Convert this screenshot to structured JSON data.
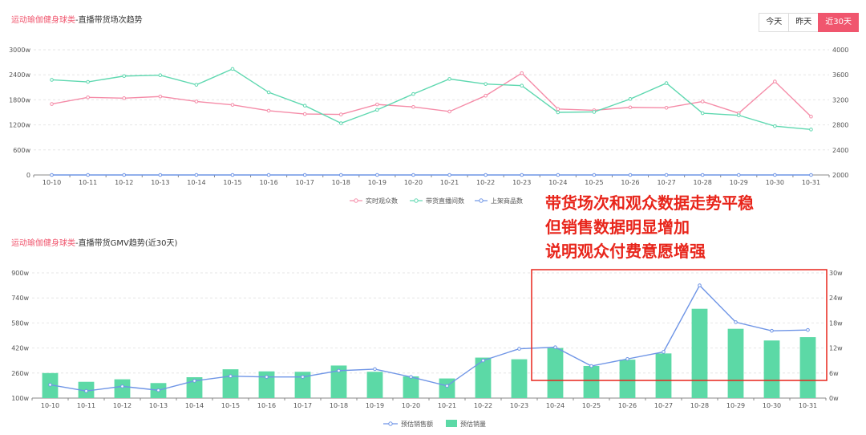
{
  "header": {
    "chart1_title_accent": "运动瑜伽健身球类",
    "chart1_title_rest": "-直播带货场次趋势",
    "chart2_title_accent": "运动瑜伽健身球类",
    "chart2_title_rest": "-直播带货GMV趋势(近30天)"
  },
  "range_buttons": [
    {
      "label": "今天",
      "active": false
    },
    {
      "label": "昨天",
      "active": false
    },
    {
      "label": "近30天",
      "active": true
    }
  ],
  "annotation": {
    "lines": [
      "带货场次和观众数据走势平稳",
      "但销售数据明显增加",
      "说明观众付费意愿增强"
    ],
    "color": "#e8251b"
  },
  "colors": {
    "pink": "#f58ca8",
    "teal": "#5fd8b0",
    "blue": "#6f95e6",
    "bar": "#5cd9a6"
  },
  "chart_data": [
    {
      "type": "line",
      "categories": [
        "10-10",
        "10-11",
        "10-12",
        "10-13",
        "10-14",
        "10-15",
        "10-16",
        "10-17",
        "10-18",
        "10-19",
        "10-20",
        "10-21",
        "10-22",
        "10-23",
        "10-24",
        "10-25",
        "10-26",
        "10-27",
        "10-28",
        "10-29",
        "10-30",
        "10-31"
      ],
      "y_left": {
        "min": 0,
        "max": 3000,
        "ticks": [
          "0",
          "600w",
          "1200w",
          "1800w",
          "2400w",
          "3000w"
        ]
      },
      "y_right": {
        "min": 2000,
        "max": 4000,
        "ticks": [
          "2000",
          "2400",
          "2800",
          "3200",
          "3600",
          "4000"
        ]
      },
      "grid": true,
      "legend_position": "bottom",
      "series": [
        {
          "name": "实时观众数",
          "axis": "left",
          "values": [
            1700,
            1860,
            1840,
            1880,
            1760,
            1680,
            1540,
            1460,
            1450,
            1690,
            1630,
            1520,
            1900,
            2440,
            1580,
            1550,
            1620,
            1610,
            1760,
            1480,
            2240,
            1400
          ]
        },
        {
          "name": "带货直播间数",
          "axis": "left",
          "values": [
            2280,
            2230,
            2370,
            2390,
            2160,
            2540,
            1980,
            1660,
            1240,
            1560,
            1940,
            2300,
            2180,
            2140,
            1500,
            1510,
            1820,
            2200,
            1480,
            1430,
            1170,
            1090
          ]
        },
        {
          "name": "上架商品数",
          "axis": "left",
          "values": [
            0,
            0,
            0,
            0,
            0,
            0,
            0,
            0,
            0,
            0,
            0,
            0,
            0,
            0,
            0,
            0,
            0,
            0,
            0,
            0,
            0,
            0
          ]
        }
      ]
    },
    {
      "type": "bar",
      "categories": [
        "10-10",
        "10-11",
        "10-12",
        "10-13",
        "10-14",
        "10-15",
        "10-16",
        "10-17",
        "10-18",
        "10-19",
        "10-20",
        "10-21",
        "10-22",
        "10-23",
        "10-24",
        "10-25",
        "10-26",
        "10-27",
        "10-28",
        "10-29",
        "10-30",
        "10-31"
      ],
      "y_left": {
        "min": 100,
        "max": 900,
        "ticks": [
          "100w",
          "260w",
          "420w",
          "580w",
          "740w",
          "900w"
        ]
      },
      "y_right": {
        "min": 0,
        "max": 30,
        "ticks": [
          "0w",
          "6w",
          "12w",
          "18w",
          "24w",
          "30w"
        ]
      },
      "grid": true,
      "legend_position": "bottom",
      "series": [
        {
          "name": "预估销售额",
          "kind": "line",
          "axis": "left",
          "values": [
            185,
            145,
            175,
            150,
            210,
            240,
            235,
            235,
            275,
            285,
            235,
            178,
            340,
            415,
            425,
            305,
            350,
            395,
            820,
            585,
            530,
            535
          ]
        },
        {
          "name": "预估销量",
          "kind": "bar",
          "axis": "right",
          "values": [
            6.0,
            3.9,
            4.5,
            3.6,
            5.0,
            6.9,
            6.4,
            6.3,
            7.8,
            6.3,
            5.2,
            4.7,
            9.7,
            9.3,
            12.0,
            7.7,
            9.2,
            10.7,
            21.4,
            16.6,
            13.8,
            14.6
          ]
        }
      ]
    }
  ]
}
